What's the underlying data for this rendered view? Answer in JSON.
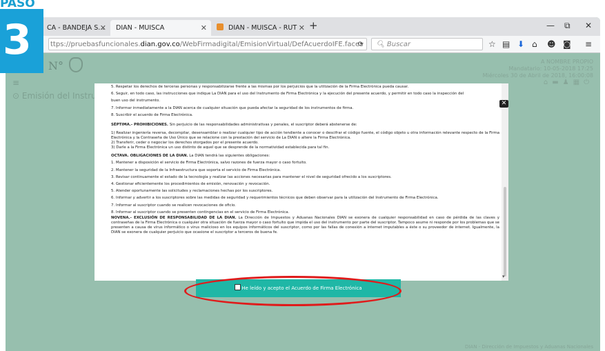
{
  "step": {
    "label": "PASO",
    "number": "3"
  },
  "tabs": [
    {
      "label": "CA - BANDEJA S..."
    },
    {
      "label": "DIAN - MUISCA"
    },
    {
      "label": "DIAN - MUISCA - RUT"
    }
  ],
  "address": {
    "prefix": "ttps://pruebasfuncionales.",
    "domain": "dian.gov.co",
    "path": "/WebFirmadigital/EmisionVirtual/DefAcuerdoIFE.faces"
  },
  "search": {
    "placeholder": "Buscar"
  },
  "site": {
    "logo_text": "N°",
    "breadcrumb": "Emisión del Instrumento de Firma Electrónica",
    "user_line1": "A NOMBRE PROPIO",
    "user_line2": "Mandatario: 10-05-2018 17:25",
    "user_line3": "Miércoles 30 de Abril de 2018, 16:00:08",
    "footer": "DIAN - Dirección de Impuestos y Aduanas Nacionales"
  },
  "agreement": {
    "lines": [
      "5. Respetar los derechos de terceras personas y responsabilizarse frente a las mismas por los perjuicios que la utilización de la Firma Electrónica pueda causar.",
      "6. Seguir, en todo caso, las instrucciones que indique La DIAN para el uso del Instrumento de Firma Electrónica y la ejecución del presente acuerdo, y permitir en todo caso la inspección del",
      "   buen uso del instrumento.",
      "7. Informar inmediatamente a la DIAN acerca de cualquier situación que pueda afectar la seguridad de los instrumentos de firma.",
      "8. Suscribir el acuerdo de Firma Electrónica."
    ],
    "septima_title": "SÉPTIMA.- PROHIBICIONES.",
    "septima_text": "Sin perjuicio de las responsabilidades administrativas y penales, el suscriptor deberá abstenerse de:",
    "septima_items": "1) Realizar ingeniería reversa, decompilar, desensamblar o realizar cualquier tipo de acción tendiente a conocer o descifrar el código fuente, el código objeto u otra información relevante respecto de la Firma Electrónica y la Contraseña de Uso Único que se relacione con la prestación del servicio de La DIAN o altere la Firma Electrónica.\n2) Transferir, ceder o negociar los derechos otorgados por el presente acuerdo.\n3) Darle a la Firma Electrónica un uso distinto de aquel que se desprende de la normatividad establecida para tal fin.",
    "octava_title": "OCTAVA. OBLIGACIONES DE LA DIAN.",
    "octava_text": "La DIAN tendrá las siguientes obligaciones:",
    "octava_items": [
      "1. Mantener a disposición el servicio de Firma Electrónica, salvo razones de fuerza mayor o caso fortuito.",
      "2. Mantener la seguridad de la Infraestructura que soporta el servicio de Firma Electrónica.",
      "3. Revisar continuamente el estado de la tecnología y realizar las acciones necesarias para mantener el nivel de seguridad ofrecido a los suscriptores.",
      "4. Gestionar eficientemente los procedimientos de emisión, renovación y revocación.",
      "5. Atender oportunamente las solicitudes y reclamaciones hechas por los suscriptores.",
      "6. Informar y advertir a los suscriptores sobre las medidas de seguridad y requerimientos técnicos que deben observar para la utilización del Instrumento de Firma Electrónica.",
      "7. Informar al suscriptor cuando se realicen revocaciones de oficio.",
      "8. Informar al suscriptor cuando se presenten contingencias en el servicio de Firma Electrónica."
    ],
    "novena_title": "NOVENA.- EXCLUSIÓN DE RESPONSABILIDAD DE LA DIAN.",
    "novena_text": "La Dirección de Impuestos y Aduanas Nacionales DIAN se exonera de cualquier responsabilidad en caso de pérdida de las claves y contraseñas de la Firma Electrónica o cualquier otra situación de fuerza mayor o caso fortuito que impida el uso del instrumento por parte del suscriptor. Tampoco asume ni responde por los problemas que se presenten a causa de virus informático o virus malicioso en los equipos informáticos del suscriptor, como por las fallas de conexión a internet imputables a éste o su proveedor de internet. Igualmente, la DIAN se exonera de cualquier perjuicio que ocasione el suscriptor a terceros de buena fe.",
    "accept_label": "He leído y acepto el Acuerdo de Firma Electrónica"
  }
}
